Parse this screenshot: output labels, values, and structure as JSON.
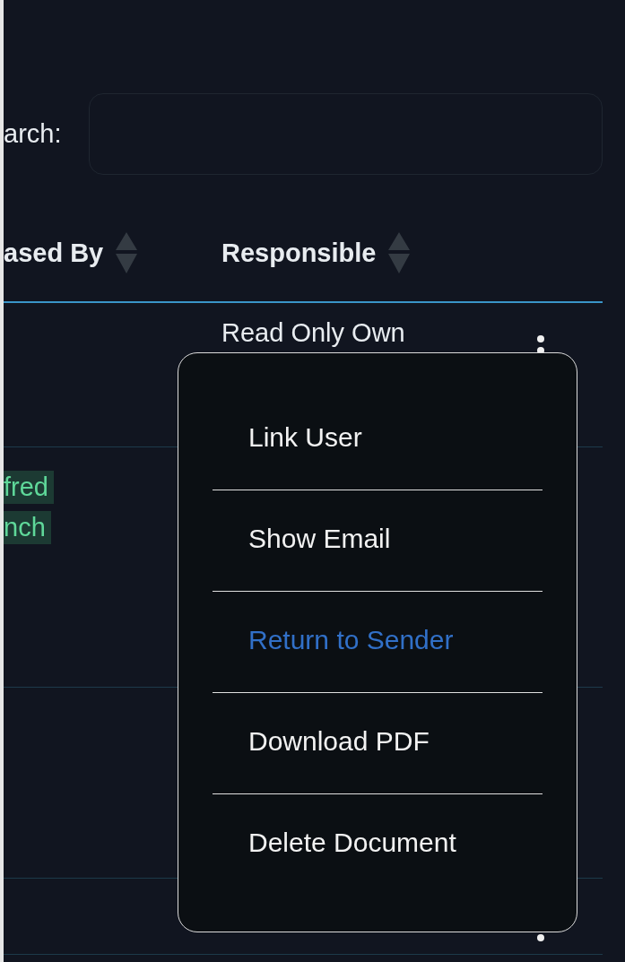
{
  "search": {
    "label": "arch:"
  },
  "table": {
    "columns": [
      {
        "label": "ased By",
        "sortable": true
      },
      {
        "label": "Responsible",
        "sortable": true
      }
    ],
    "rows": [
      {
        "responsible": "Read Only Own",
        "menu_button": true
      },
      {
        "tags": [
          "fred",
          "nch"
        ],
        "menu_button": false
      },
      {
        "menu_button": false
      },
      {
        "menu_button": true
      }
    ]
  },
  "context_menu": {
    "items": [
      {
        "label": "Link User",
        "highlighted": false
      },
      {
        "label": "Show Email",
        "highlighted": false
      },
      {
        "label": "Return to Sender",
        "highlighted": true
      },
      {
        "label": "Download PDF",
        "highlighted": false
      },
      {
        "label": "Delete Document",
        "highlighted": false
      }
    ]
  }
}
